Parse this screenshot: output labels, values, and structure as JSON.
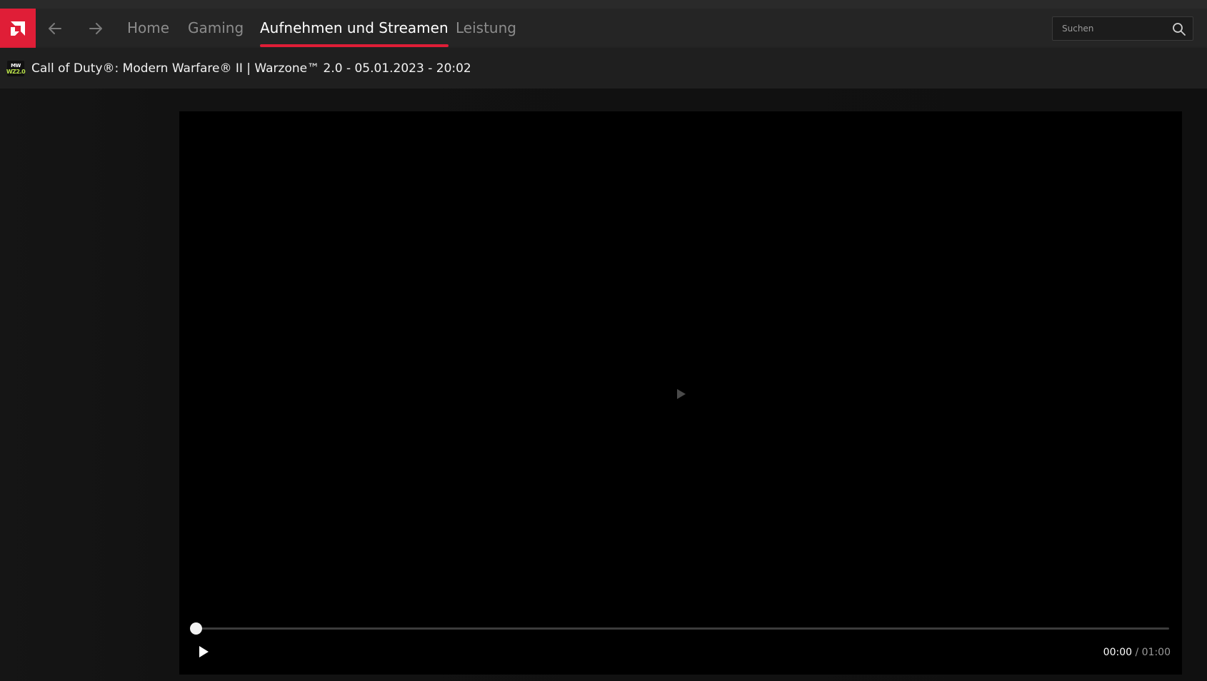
{
  "nav": {
    "tabs": [
      {
        "label": "Home",
        "active": false
      },
      {
        "label": "Gaming",
        "active": false
      },
      {
        "label": "Aufnehmen und Streamen",
        "active": true
      },
      {
        "label": "Leistung",
        "active": false
      }
    ],
    "search_placeholder": "Suchen",
    "icons": {
      "logo": "amd-logo-icon",
      "back": "arrow-left-icon",
      "forward": "arrow-right-icon",
      "search": "search-icon"
    }
  },
  "subheader": {
    "game_icon_lines": [
      "MW",
      "WZ2.0"
    ],
    "title": "Call of Duty®: Modern Warfare® II | Warzone™ 2.0 - 05.01.2023 - 20:02"
  },
  "player": {
    "current_time": "00:00",
    "separator": "/",
    "duration": "01:00",
    "progress": 0
  },
  "colors": {
    "accent": "#e01e37",
    "topbar": "#252525",
    "subheader": "#1f1f1f",
    "video_bg": "#000000"
  }
}
